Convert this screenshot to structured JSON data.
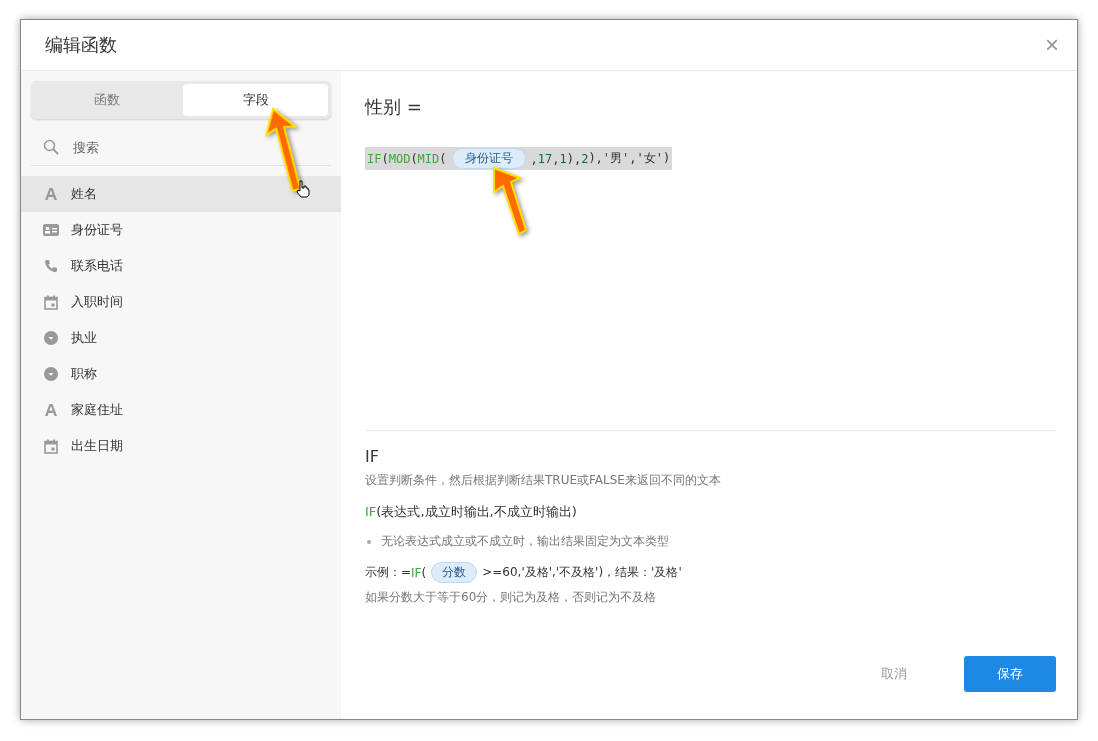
{
  "dialog": {
    "title": "编辑函数",
    "close": "×"
  },
  "tabs": [
    {
      "label": "函数",
      "selected": false
    },
    {
      "label": "字段",
      "selected": true
    }
  ],
  "search": {
    "placeholder": "搜索"
  },
  "fields": [
    {
      "kind": "text",
      "label": "姓名",
      "selected": true
    },
    {
      "kind": "idcard",
      "label": "身份证号",
      "selected": false
    },
    {
      "kind": "phone",
      "label": "联系电话",
      "selected": false
    },
    {
      "kind": "date",
      "label": "入职时间",
      "selected": false
    },
    {
      "kind": "select",
      "label": "执业",
      "selected": false
    },
    {
      "kind": "select",
      "label": "职称",
      "selected": false
    },
    {
      "kind": "text",
      "label": "家庭住址",
      "selected": false
    },
    {
      "kind": "date",
      "label": "出生日期",
      "selected": false
    }
  ],
  "formula": {
    "target": "性别 =",
    "tokens": [
      {
        "kind": "fn",
        "text": "IF"
      },
      {
        "kind": "punct",
        "text": "("
      },
      {
        "kind": "fn",
        "text": "MOD"
      },
      {
        "kind": "punct",
        "text": "("
      },
      {
        "kind": "fn",
        "text": "MID"
      },
      {
        "kind": "punct",
        "text": "("
      },
      {
        "kind": "field",
        "text": "身份证号"
      },
      {
        "kind": "punct",
        "text": ","
      },
      {
        "kind": "num",
        "text": "17"
      },
      {
        "kind": "punct",
        "text": ","
      },
      {
        "kind": "num",
        "text": "1"
      },
      {
        "kind": "punct",
        "text": "),"
      },
      {
        "kind": "num",
        "text": "2"
      },
      {
        "kind": "punct",
        "text": "),'男','女')"
      }
    ]
  },
  "help": {
    "name": "IF",
    "description": "设置判断条件，然后根据判断结果TRUE或FALSE来返回不同的文本",
    "syntax": [
      {
        "kind": "fn",
        "text": "IF"
      },
      {
        "kind": "punct",
        "text": "(表达式,成立时输出,不成立时输出)"
      }
    ],
    "notes": [
      "无论表达式成立或不成立时，输出结果固定为文本类型"
    ],
    "example": [
      {
        "kind": "punct",
        "text": "示例：="
      },
      {
        "kind": "fn",
        "text": "IF"
      },
      {
        "kind": "punct",
        "text": "("
      },
      {
        "kind": "field",
        "text": "分数"
      },
      {
        "kind": "punct",
        "text": ">=60,'及格','不及格')，结果：'及格'"
      }
    ],
    "explanation": "如果分数大于等于60分，则记为及格，否则记为不及格"
  },
  "buttons": [
    {
      "kind": "secondary",
      "label": "取消"
    },
    {
      "kind": "primary",
      "label": "保存"
    }
  ]
}
